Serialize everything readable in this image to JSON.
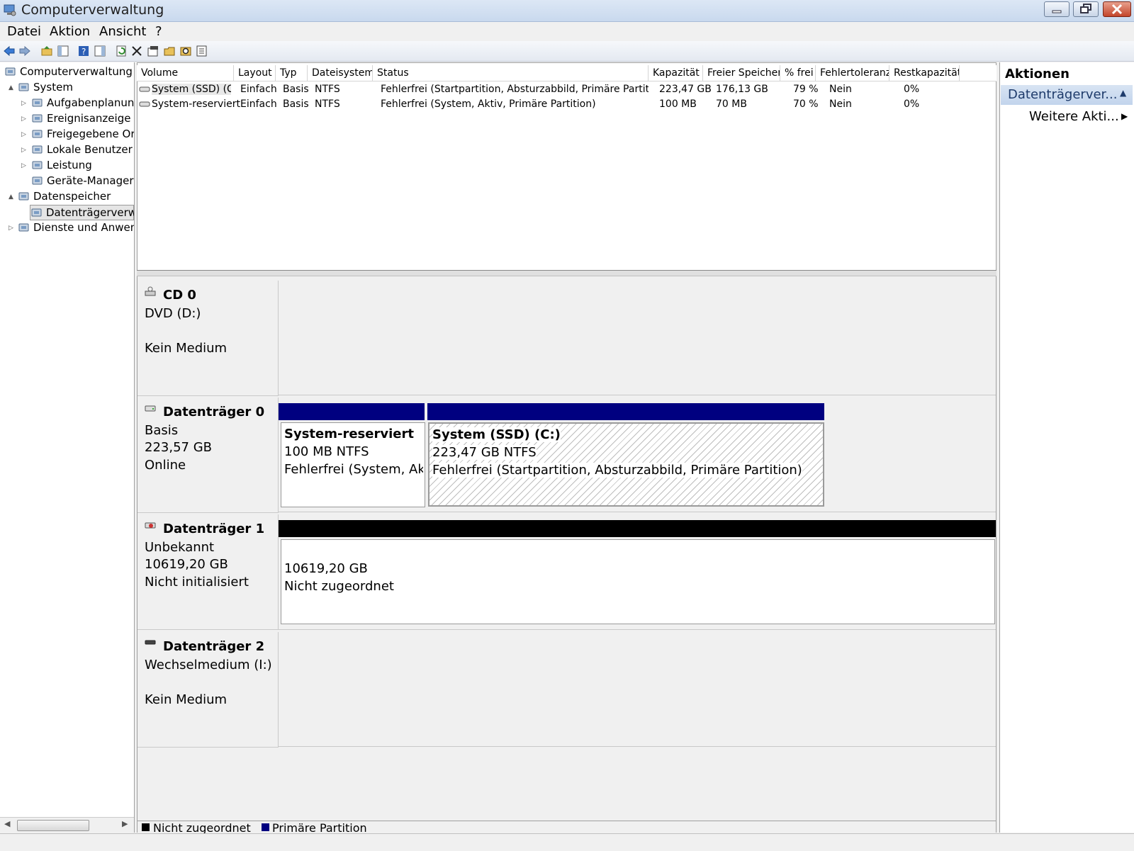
{
  "window": {
    "title": "Computerverwaltung"
  },
  "menu": {
    "items": [
      "Datei",
      "Aktion",
      "Ansicht",
      "?"
    ]
  },
  "toolbar": {
    "icons": [
      "back-arrow-icon",
      "forward-arrow-icon",
      "up-folder-icon",
      "show-hide-tree-icon",
      "help-icon",
      "show-hide-action-pane-icon",
      "refresh-icon",
      "delete-icon",
      "properties-icon",
      "open-icon",
      "search-icon",
      "export-icon"
    ]
  },
  "tree": {
    "items": [
      {
        "label": "Computerverwaltung (Lo",
        "icon": "computer-management-icon",
        "level": 0,
        "expander": ""
      },
      {
        "label": "System",
        "icon": "tools-icon",
        "level": 1,
        "expander": "▲"
      },
      {
        "label": "Aufgabenplanung",
        "icon": "clock-icon",
        "level": 2,
        "expander": "▷"
      },
      {
        "label": "Ereignisanzeige",
        "icon": "event-viewer-icon",
        "level": 2,
        "expander": "▷"
      },
      {
        "label": "Freigegebene Ordn",
        "icon": "shared-folder-icon",
        "level": 2,
        "expander": "▷"
      },
      {
        "label": "Lokale Benutzer un",
        "icon": "users-icon",
        "level": 2,
        "expander": "▷"
      },
      {
        "label": "Leistung",
        "icon": "performance-icon",
        "level": 2,
        "expander": "▷"
      },
      {
        "label": "Geräte-Manager",
        "icon": "device-manager-icon",
        "level": 2,
        "expander": ""
      },
      {
        "label": "Datenspeicher",
        "icon": "storage-icon",
        "level": 1,
        "expander": "▲"
      },
      {
        "label": "Datenträgerverwalt",
        "icon": "disk-management-icon",
        "level": 2,
        "expander": "",
        "selected": true
      },
      {
        "label": "Dienste und Anwendu",
        "icon": "services-icon",
        "level": 1,
        "expander": "▷"
      }
    ]
  },
  "volumes": {
    "columns": [
      "Volume",
      "Layout",
      "Typ",
      "Dateisystem",
      "Status",
      "Kapazität",
      "Freier Speicher",
      "% frei",
      "Fehlertoleranz",
      "Restkapazität"
    ],
    "rows": [
      [
        "System (SSD) (C:)",
        "Einfach",
        "Basis",
        "NTFS",
        "Fehlerfrei (Startpartition, Absturzabbild, Primäre Partition)",
        "223,47 GB",
        "176,13 GB",
        "79 %",
        "Nein",
        "0%"
      ],
      [
        "System-reserviert",
        "Einfach",
        "Basis",
        "NTFS",
        "Fehlerfrei (System, Aktiv, Primäre Partition)",
        "100 MB",
        "70 MB",
        "70 %",
        "Nein",
        "0%"
      ]
    ]
  },
  "disks": {
    "cd0": {
      "name": "CD 0",
      "line1": "DVD (D:)",
      "line2": "",
      "line3": "Kein Medium"
    },
    "disk0": {
      "name": "Datenträger 0",
      "line1": "Basis",
      "line2": "223,57 GB",
      "line3": "Online",
      "partitions": [
        {
          "title": "System-reserviert",
          "size": "100 MB NTFS",
          "status": "Fehlerfrei (System, Aktiv"
        },
        {
          "title": "System (SSD)  (C:)",
          "size": "223,47 GB NTFS",
          "status": "Fehlerfrei (Startpartition, Absturzabbild, Primäre Partition)"
        }
      ]
    },
    "disk1": {
      "name": "Datenträger 1",
      "line1": "Unbekannt",
      "line2": "10619,20 GB",
      "line3": "Nicht initialisiert",
      "partitions": [
        {
          "size": "10619,20 GB",
          "status": "Nicht zugeordnet"
        }
      ]
    },
    "disk2": {
      "name": "Datenträger 2",
      "line1": "Wechselmedium (I:)",
      "line2": "",
      "line3": "Kein Medium"
    }
  },
  "legend": {
    "unallocated": "Nicht zugeordnet",
    "primary": "Primäre Partition"
  },
  "actions": {
    "title": "Aktionen",
    "section": "Datenträgerver...",
    "more": "Weitere Akti..."
  },
  "colors": {
    "primary": "#000080",
    "unallocated": "#000000",
    "title_bar": "#c9d9ee"
  }
}
